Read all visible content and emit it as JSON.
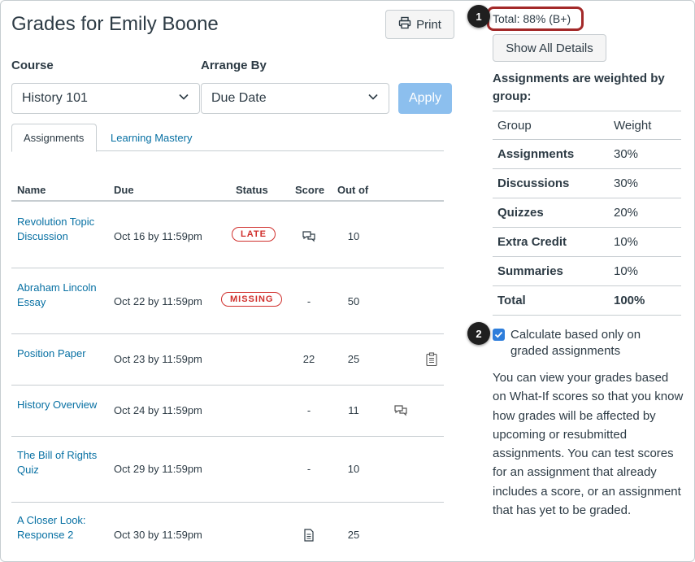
{
  "header": {
    "title": "Grades for Emily Boone",
    "print_label": "Print"
  },
  "filters": {
    "course_label": "Course",
    "course_value": "History 101",
    "arrange_label": "Arrange By",
    "arrange_value": "Due Date",
    "apply_label": "Apply"
  },
  "tabs": [
    {
      "label": "Assignments",
      "active": true
    },
    {
      "label": "Learning Mastery",
      "active": false
    }
  ],
  "table": {
    "headers": {
      "name": "Name",
      "due": "Due",
      "status": "Status",
      "score": "Score",
      "out_of": "Out of"
    },
    "rows": [
      {
        "name": "Revolution Topic Discussion",
        "due": "Oct 16 by 11:59pm",
        "status": "LATE",
        "score": "",
        "score_icon": "discussion-icon",
        "out_of": "10",
        "extra_icon": ""
      },
      {
        "name": "Abraham Lincoln Essay",
        "due": "Oct 22 by 11:59pm",
        "status": "MISSING",
        "score": "-",
        "out_of": "50",
        "extra_icon": ""
      },
      {
        "name": "Position Paper",
        "due": "Oct 23 by 11:59pm",
        "status": "",
        "score": "22",
        "out_of": "25",
        "extra_icon": "rubric-icon"
      },
      {
        "name": "History Overview",
        "due": "Oct 24 by 11:59pm",
        "status": "",
        "score": "-",
        "out_of": "11",
        "extra_icon": "comments-icon"
      },
      {
        "name": "The Bill of Rights Quiz",
        "due": "Oct 29 by 11:59pm",
        "status": "",
        "score": "-",
        "out_of": "10",
        "extra_icon": ""
      },
      {
        "name": "A Closer Look: Response 2",
        "due": "Oct 30 by 11:59pm",
        "status": "",
        "score": "",
        "score_icon": "document-icon",
        "out_of": "25",
        "extra_icon": ""
      }
    ]
  },
  "sidebar": {
    "total": "Total: 88% (B+)",
    "show_details_label": "Show All Details",
    "weight_heading": "Assignments are weighted by group:",
    "weights": {
      "header": {
        "group": "Group",
        "weight": "Weight"
      },
      "rows": [
        {
          "group": "Assignments",
          "weight": "30%"
        },
        {
          "group": "Discussions",
          "weight": "30%"
        },
        {
          "group": "Quizzes",
          "weight": "20%"
        },
        {
          "group": "Extra Credit",
          "weight": "10%"
        },
        {
          "group": "Summaries",
          "weight": "10%"
        },
        {
          "group": "Total",
          "weight": "100%"
        }
      ]
    },
    "calculate_label": "Calculate based only on graded assignments",
    "calculate_checked": true,
    "info_text": "You can view your grades based on What-If scores so that you know how grades will be affected by upcoming or resubmitted assignments. You can test scores for an assignment that already includes a score, or an assignment that has yet to be graded."
  },
  "callouts": [
    "1",
    "2"
  ],
  "colors": {
    "link": "#0770a3",
    "danger": "#d0302d",
    "apply_disabled": "#8cbfee",
    "highlight_ring": "#a32929",
    "checkbox": "#2d7ddb"
  }
}
